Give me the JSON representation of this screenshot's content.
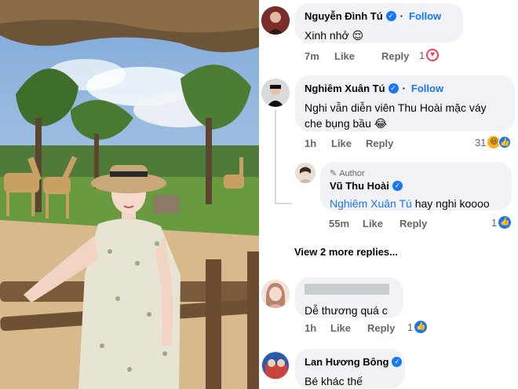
{
  "comments": [
    {
      "name": "Nguyễn Đình Tú",
      "follow": "Follow",
      "text": "Xinh nhở 😌",
      "time": "7m",
      "like": "Like",
      "reply": "Reply",
      "reaction_count": "1",
      "reaction_icon": "heart-icon"
    },
    {
      "name": "Nghiêm Xuân Tú",
      "follow": "Follow",
      "text": "Nghi vẫn diễn viên Thu Hoài mặc váy che bụng bầu 😂",
      "time": "1h",
      "like": "Like",
      "reply": "Reply",
      "reaction_count": "31",
      "reaction_icon": "haha-like-icons"
    },
    {
      "author_label": "Author",
      "name": "Vũ Thu Hoài",
      "mention": "Nghiêm Xuân Tú",
      "text": " hay nghi koooo",
      "time": "55m",
      "like": "Like",
      "reply": "Reply",
      "reaction_count": "1",
      "reaction_icon": "like-icon"
    },
    {
      "name": "",
      "text": "Dễ thương quá c",
      "time": "1h",
      "like": "Like",
      "reply": "Reply",
      "reaction_count": "1",
      "reaction_icon": "like-icon"
    },
    {
      "name": "Lan Hương Bông",
      "text": "Bé khác thế"
    }
  ],
  "view_more": "View 2 more replies...",
  "colors": {
    "accent": "#1877f2",
    "bubble": "#f0f2f5",
    "meta": "#65676b",
    "heart": "#f33e58",
    "haha": "#f7b125"
  }
}
